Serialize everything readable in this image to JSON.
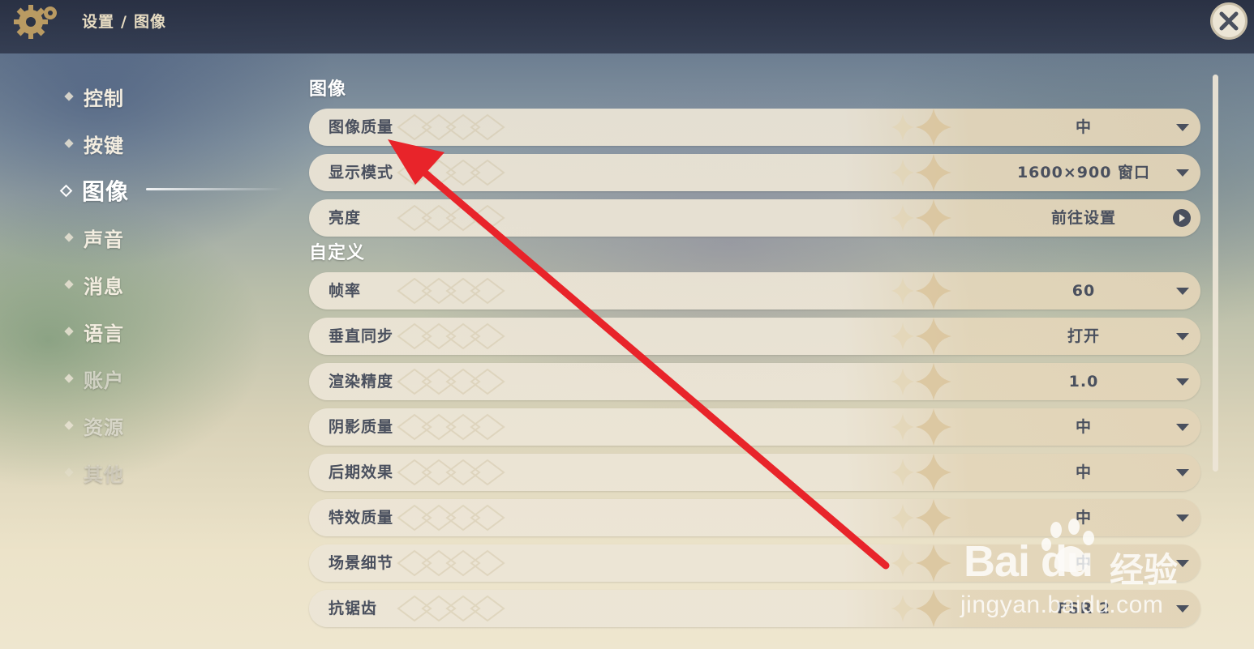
{
  "header": {
    "breadcrumb": [
      "设置",
      "图像"
    ],
    "separator": "/"
  },
  "sidebar": {
    "items": [
      {
        "label": "控制"
      },
      {
        "label": "按键"
      },
      {
        "label": "图像",
        "active": true
      },
      {
        "label": "声音"
      },
      {
        "label": "消息"
      },
      {
        "label": "语言"
      },
      {
        "label": "账户"
      },
      {
        "label": "资源"
      },
      {
        "label": "其他"
      }
    ]
  },
  "sections": {
    "image": {
      "title": "图像",
      "rows": [
        {
          "name": "图像质量",
          "value": "中"
        },
        {
          "name": "显示模式",
          "value": "1600×900 窗口"
        },
        {
          "name": "亮度",
          "value": "前往设置"
        }
      ]
    },
    "custom": {
      "title": "自定义",
      "rows": [
        {
          "name": "帧率",
          "value": "60"
        },
        {
          "name": "垂直同步",
          "value": "打开"
        },
        {
          "name": "渲染精度",
          "value": "1.0"
        },
        {
          "name": "阴影质量",
          "value": "中"
        },
        {
          "name": "后期效果",
          "value": "中"
        },
        {
          "name": "特效质量",
          "value": "中"
        },
        {
          "name": "场景细节",
          "value": "中"
        },
        {
          "name": "抗锯齿",
          "value": "FSR 2"
        }
      ]
    }
  },
  "watermark": {
    "logo": "Bai du",
    "cn": "经验",
    "url": "jingyan.baidu.com"
  },
  "colors": {
    "annotation_arrow": "#e8242a",
    "text_dark": "#4a505e",
    "row_bg": "#ece5d6"
  },
  "icons": [
    "gear-icon",
    "close-icon",
    "dropdown-arrow-icon",
    "go-circle-icon"
  ]
}
